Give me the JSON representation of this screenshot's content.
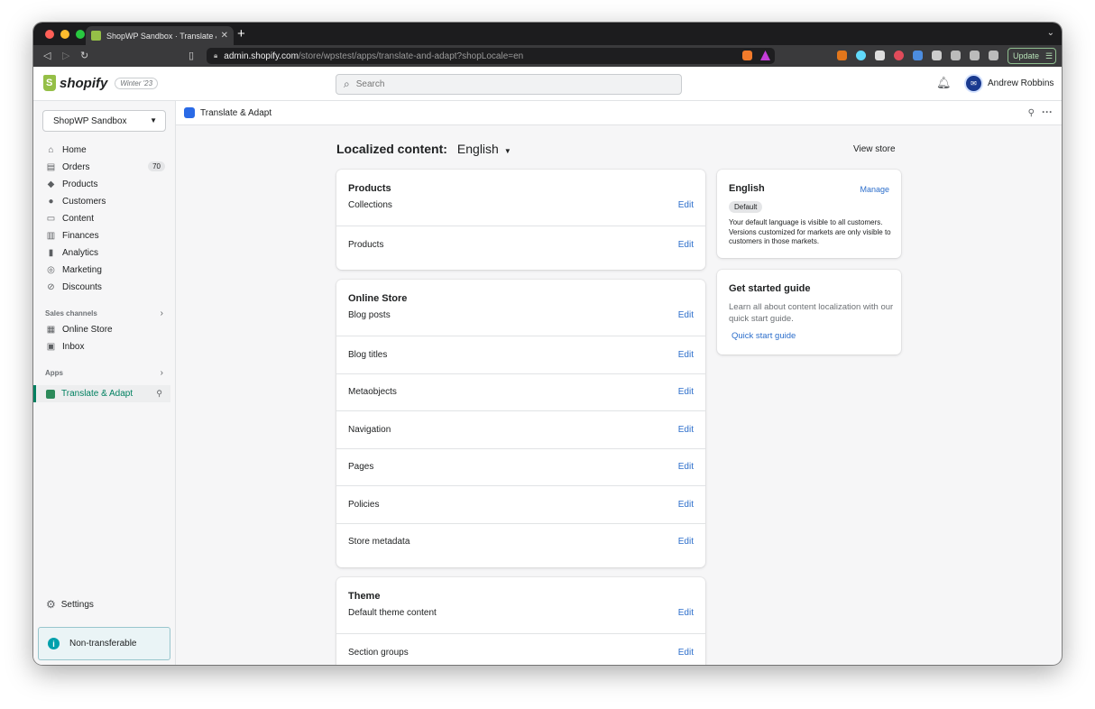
{
  "browser": {
    "tab_title": "ShopWP Sandbox · Translate &",
    "url_host": "admin.shopify.com",
    "url_path": "/store/wpstest/apps/translate-and-adapt?shopLocale=en",
    "update_label": "Update"
  },
  "header": {
    "logo_text": "shopify",
    "edition": "Winter '23",
    "search_placeholder": "Search",
    "user_name": "Andrew Robbins"
  },
  "sidebar": {
    "store_name": "ShopWP Sandbox",
    "items": [
      {
        "label": "Home",
        "icon": "⌂"
      },
      {
        "label": "Orders",
        "icon": "▤",
        "count": "70"
      },
      {
        "label": "Products",
        "icon": "◆"
      },
      {
        "label": "Customers",
        "icon": "●"
      },
      {
        "label": "Content",
        "icon": "▭"
      },
      {
        "label": "Finances",
        "icon": "▥"
      },
      {
        "label": "Analytics",
        "icon": "▮"
      },
      {
        "label": "Marketing",
        "icon": "◎"
      },
      {
        "label": "Discounts",
        "icon": "⊘"
      }
    ],
    "sales_channels_label": "Sales channels",
    "channels": [
      {
        "label": "Online Store",
        "icon": "▦"
      },
      {
        "label": "Inbox",
        "icon": "▣"
      }
    ],
    "apps_label": "Apps",
    "active_app": "Translate & Adapt",
    "settings_label": "Settings",
    "notice": "Non-transferable"
  },
  "app_bar": {
    "app_name": "Translate & Adapt"
  },
  "page": {
    "title": "Localized content:",
    "language": "English",
    "view_store": "View store",
    "edit_label": "Edit"
  },
  "cards": [
    {
      "title": "Products",
      "rows": [
        "Collections",
        "Products"
      ]
    },
    {
      "title": "Online Store",
      "rows": [
        "Blog posts",
        "Blog titles",
        "Metaobjects",
        "Navigation",
        "Pages",
        "Policies",
        "Store metadata"
      ]
    },
    {
      "title": "Theme",
      "rows": [
        "Default theme content",
        "Section groups"
      ]
    }
  ],
  "language_card": {
    "title": "English",
    "manage": "Manage",
    "badge": "Default",
    "description": "Your default language is visible to all customers. Versions customized for markets are only visible to customers in those markets."
  },
  "guide_card": {
    "title": "Get started guide",
    "description": "Learn all about content localization with our quick start guide.",
    "link": "Quick start guide"
  },
  "colors": {
    "accent": "#008060",
    "link": "#2c6ecb",
    "chrome_dark": "#1c1c1e"
  }
}
